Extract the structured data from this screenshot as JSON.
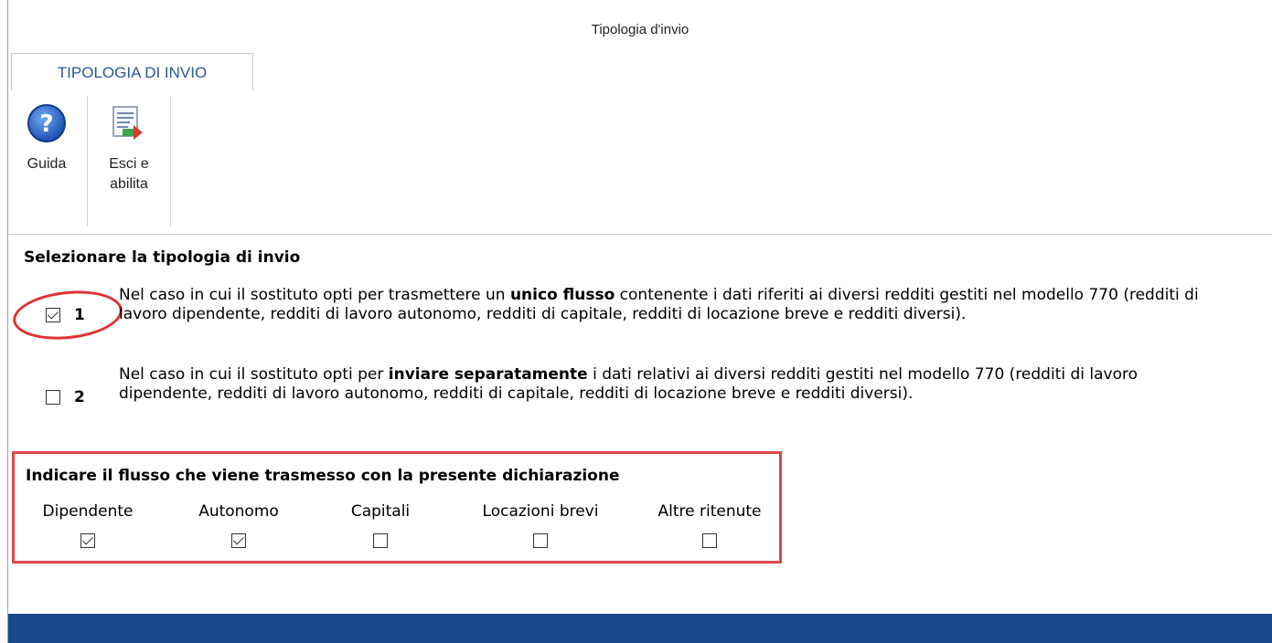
{
  "window": {
    "title": "Tipologia d'invio"
  },
  "ribbon": {
    "tab_label": "TIPOLOGIA DI INVIO",
    "help_label": "Guida",
    "exit_label_line1": "Esci e",
    "exit_label_line2": "abilita"
  },
  "section": {
    "heading": "Selezionare la tipologia di invio",
    "options": [
      {
        "number": "1",
        "checked": true,
        "text_pre": "Nel caso in cui il sostituto opti per trasmettere un ",
        "text_bold": "unico flusso",
        "text_post": " contenente i dati riferiti ai diversi redditi gestiti nel modello 770 (redditi di lavoro dipendente, redditi di lavoro autonomo, redditi di capitale, redditi di locazione breve e redditi diversi)."
      },
      {
        "number": "2",
        "checked": false,
        "text_pre": "Nel caso in cui il sostituto opti per ",
        "text_bold": "inviare separatamente",
        "text_post": " i dati relativi ai diversi redditi gestiti nel modello 770 (redditi di lavoro dipendente, redditi di lavoro autonomo, redditi di capitale, redditi di locazione breve e redditi diversi)."
      }
    ]
  },
  "flow": {
    "heading": "Indicare il flusso che viene trasmesso con la presente dichiarazione",
    "columns": [
      {
        "label": "Dipendente",
        "checked": true
      },
      {
        "label": "Autonomo",
        "checked": true
      },
      {
        "label": "Capitali",
        "checked": false
      },
      {
        "label": "Locazioni brevi",
        "checked": false
      },
      {
        "label": "Altre ritenute",
        "checked": false
      }
    ]
  },
  "icons": {
    "help": "help-circle-icon",
    "exit": "exit-enable-icon"
  },
  "colors": {
    "accent": "#2b579a",
    "highlight": "#e04848",
    "statusbar": "#1b4a8a"
  }
}
